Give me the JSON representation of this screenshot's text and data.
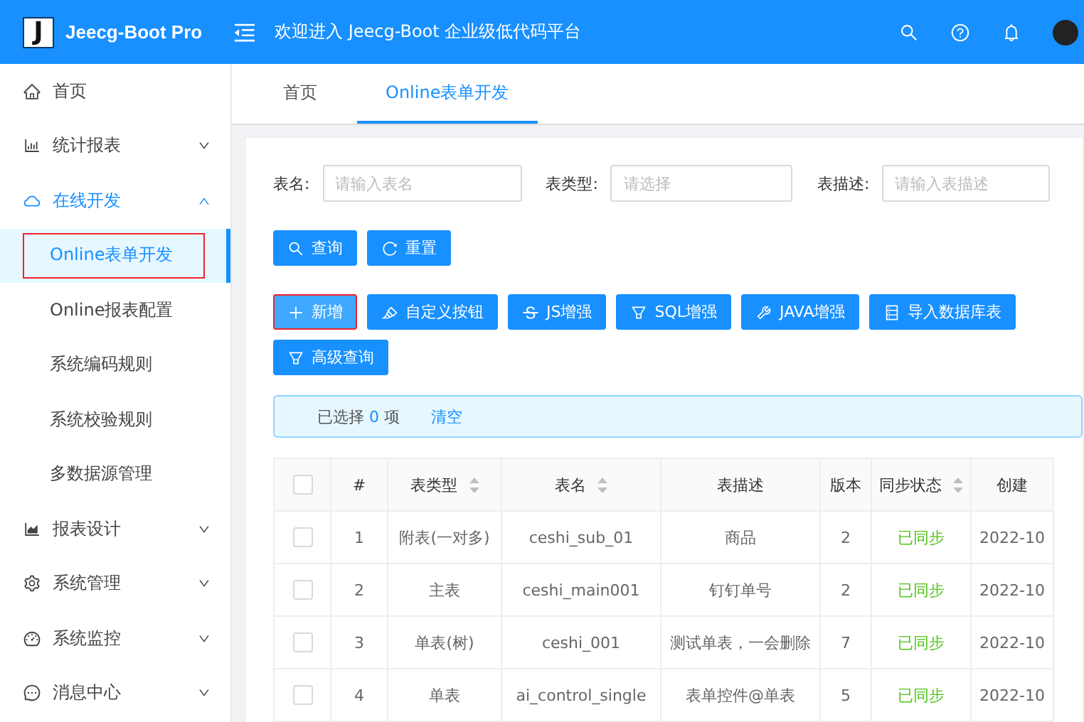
{
  "header": {
    "logo_letter": "J",
    "title": "Jeecg-Boot Pro",
    "welcome": "欢迎进入 Jeecg-Boot 企业级低代码平台"
  },
  "sidebar": {
    "items": [
      {
        "label": "首页",
        "expanded": false,
        "has_children": false
      },
      {
        "label": "统计报表",
        "expanded": false,
        "has_children": true
      },
      {
        "label": "在线开发",
        "expanded": true,
        "has_children": true,
        "children": [
          {
            "label": "Online表单开发",
            "selected": true,
            "outlined": true
          },
          {
            "label": "Online报表配置",
            "selected": false,
            "outlined": false
          },
          {
            "label": "系统编码规则",
            "selected": false,
            "outlined": false
          },
          {
            "label": "系统校验规则",
            "selected": false,
            "outlined": false
          },
          {
            "label": "多数据源管理",
            "selected": false,
            "outlined": false
          }
        ]
      },
      {
        "label": "报表设计",
        "expanded": false,
        "has_children": true
      },
      {
        "label": "系统管理",
        "expanded": false,
        "has_children": true
      },
      {
        "label": "系统监控",
        "expanded": false,
        "has_children": true
      },
      {
        "label": "消息中心",
        "expanded": false,
        "has_children": true
      }
    ]
  },
  "tabs": [
    {
      "label": "首页",
      "selected": false
    },
    {
      "label": "Online表单开发",
      "selected": true
    }
  ],
  "filters": [
    {
      "label": "表名:",
      "placeholder": "请输入表名"
    },
    {
      "label": "表类型:",
      "placeholder": "请选择"
    },
    {
      "label": "表描述:",
      "placeholder": "请输入表描述"
    }
  ],
  "query_buttons": [
    "查询",
    "重置"
  ],
  "action_buttons": [
    {
      "label": "新增",
      "outlined": true
    },
    {
      "label": "自定义按钮",
      "outlined": false
    },
    {
      "label": "JS增强",
      "outlined": false
    },
    {
      "label": "SQL增强",
      "outlined": false
    },
    {
      "label": "JAVA增强",
      "outlined": false
    },
    {
      "label": "导入数据库表",
      "outlined": false
    },
    {
      "label": "高级查询",
      "outlined": false
    }
  ],
  "selection": {
    "prefix": "已选择",
    "count": "0",
    "suffix": "项",
    "clear": "清空"
  },
  "table": {
    "all_checked": false,
    "columns": [
      {
        "label": "#",
        "sortable": false
      },
      {
        "label": "表类型",
        "sortable": true
      },
      {
        "label": "表名",
        "sortable": true
      },
      {
        "label": "表描述",
        "sortable": false
      },
      {
        "label": "版本",
        "sortable": false
      },
      {
        "label": "同步状态",
        "sortable": true
      },
      {
        "label": "创建",
        "sortable": false
      }
    ],
    "rows": [
      {
        "checked": false,
        "cells": [
          "1",
          "附表(一对多)",
          "ceshi_sub_01",
          "商品",
          "2",
          "已同步",
          "2022-10"
        ]
      },
      {
        "checked": false,
        "cells": [
          "2",
          "主表",
          "ceshi_main001",
          "钉钉单号",
          "2",
          "已同步",
          "2022-10"
        ]
      },
      {
        "checked": false,
        "cells": [
          "3",
          "单表(树)",
          "ceshi_001",
          "测试单表，一会删除",
          "7",
          "已同步",
          "2022-10"
        ]
      },
      {
        "checked": false,
        "cells": [
          "4",
          "单表",
          "ai_control_single",
          "表单控件@单表",
          "5",
          "已同步",
          "2022-10"
        ]
      }
    ]
  }
}
